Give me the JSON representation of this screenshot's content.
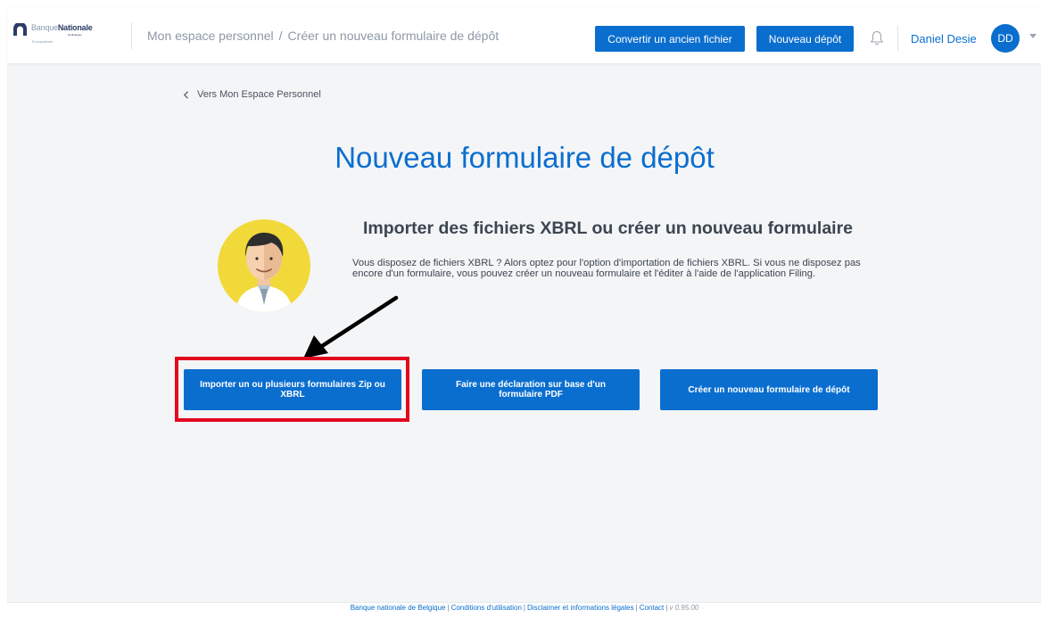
{
  "header": {
    "logo": {
      "brand_light": "Banque",
      "brand_bold": "Nationale",
      "sub": "de Belgique",
      "sub2": "Eurosystème"
    },
    "breadcrumb": {
      "home": "Mon espace personnel",
      "separator": "/",
      "current": "Créer un nouveau formulaire de dépôt"
    },
    "convert_button": "Convertir un ancien fichier",
    "new_deposit_button": "Nouveau dépôt",
    "user_name": "Daniel Desie",
    "avatar_initials": "DD"
  },
  "main": {
    "back_link": "Vers Mon Espace Personnel",
    "title": "Nouveau formulaire de dépôt",
    "section_heading": "Importer des fichiers XBRL ou créer un nouveau formulaire",
    "section_description": "Vous disposez de fichiers XBRL ? Alors optez pour l'option d'importation de fichiers XBRL. Si vous ne disposez pas encore d'un formulaire, vous pouvez créer un nouveau formulaire et l'éditer à l'aide de l'application Filing.",
    "actions": [
      {
        "label": "Importer un ou plusieurs formulaires Zip ou XBRL"
      },
      {
        "label": "Faire une déclaration sur base d'un formulaire PDF"
      },
      {
        "label": "Créer un nouveau formulaire de dépôt"
      }
    ]
  },
  "footer": {
    "links": [
      "Banque nationale de Belgique",
      "Conditions d'utilisation",
      "Disclaimer et informations légales",
      "Contact"
    ],
    "version": "v 0.95.00"
  },
  "colors": {
    "primary": "#0a6ecf",
    "highlight": "#e2091e",
    "background": "#f4f5f7"
  }
}
